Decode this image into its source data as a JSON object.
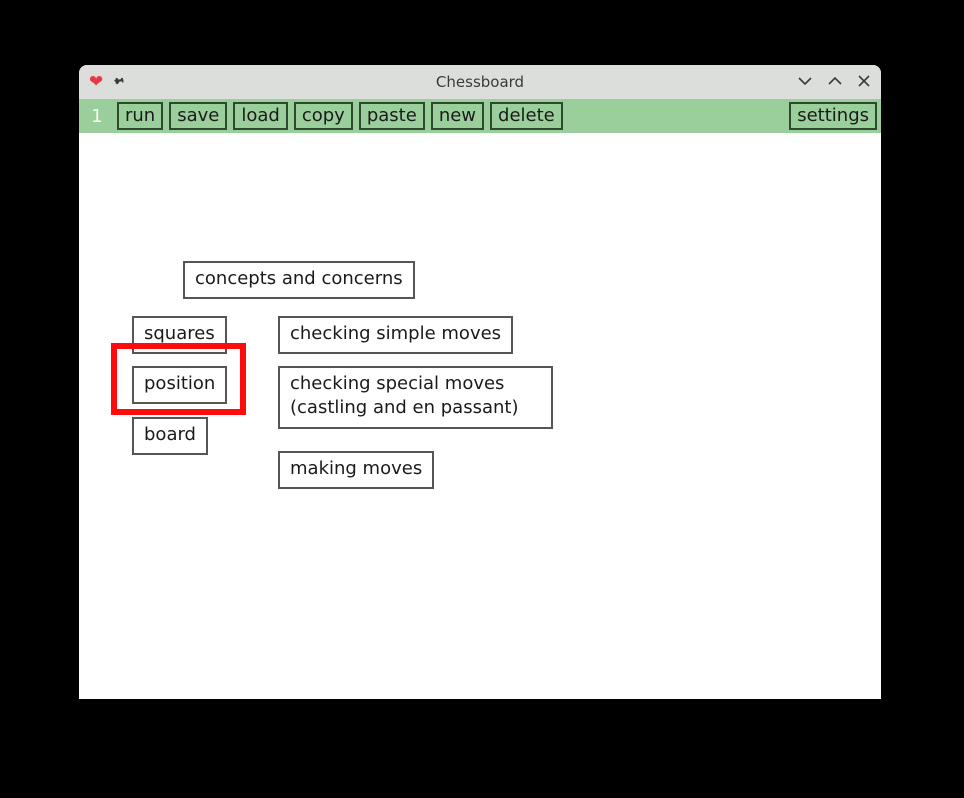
{
  "window": {
    "title": "Chessboard"
  },
  "toolbar": {
    "index": "1",
    "buttons": {
      "run": "run",
      "save": "save",
      "load": "load",
      "copy": "copy",
      "paste": "paste",
      "new": "new",
      "delete": "delete",
      "settings": "settings"
    }
  },
  "nodes": {
    "concepts": "concepts and concerns",
    "squares": "squares",
    "position": "position",
    "board": "board",
    "check_simple": "checking simple moves",
    "check_special_l1": "checking special moves",
    "check_special_l2": "(castling and en passant)",
    "making_moves": "making moves"
  }
}
